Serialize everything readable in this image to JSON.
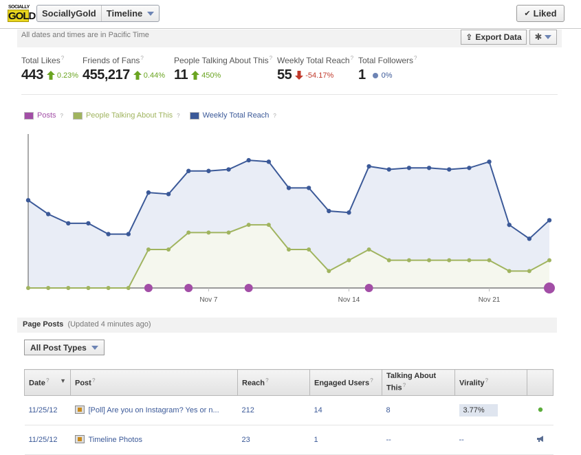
{
  "app": {
    "logo": {
      "line1": "SOCIALLY",
      "line2": "GOLD"
    },
    "page_name": "SociallyGold",
    "view_selector": "Timeline",
    "liked_button": "Liked"
  },
  "toolbar": {
    "timezone_note": "All dates and times are in Pacific Time",
    "export_label": "Export Data",
    "settings_icon": "gear-icon"
  },
  "stats": [
    {
      "label": "Total Likes",
      "value": "443",
      "change": "0.23%",
      "direction": "up"
    },
    {
      "label": "Friends of Fans",
      "value": "455,217",
      "change": "0.44%",
      "direction": "up"
    },
    {
      "label": "People Talking About This",
      "value": "11",
      "change": "450%",
      "direction": "up"
    },
    {
      "label": "Weekly Total Reach",
      "value": "55",
      "change": "-54.17%",
      "direction": "down"
    },
    {
      "label": "Total Followers",
      "value": "1",
      "change": "0%",
      "direction": "neutral"
    }
  ],
  "colors": {
    "posts": "#a24ea6",
    "talking": "#a0b45f",
    "reach": "#3b5998",
    "up": "#6aa421",
    "down": "#c0392b"
  },
  "chart_data": {
    "type": "line",
    "title": "",
    "xlabel": "",
    "ylabel": "",
    "legend": [
      "Posts",
      "People Talking About This",
      "Weekly Total Reach"
    ],
    "legend_position": "top-left",
    "x": [
      "Oct 29",
      "Oct 30",
      "Oct 31",
      "Nov 1",
      "Nov 2",
      "Nov 3",
      "Nov 4",
      "Nov 5",
      "Nov 6",
      "Nov 7",
      "Nov 8",
      "Nov 9",
      "Nov 10",
      "Nov 11",
      "Nov 12",
      "Nov 13",
      "Nov 14",
      "Nov 15",
      "Nov 16",
      "Nov 17",
      "Nov 18",
      "Nov 19",
      "Nov 20",
      "Nov 21",
      "Nov 22",
      "Nov 23",
      "Nov 24"
    ],
    "x_ticks": [
      "Nov 7",
      "Nov 14",
      "Nov 21"
    ],
    "ylim": [
      0,
      100
    ],
    "y_axis_labels_shown": false,
    "series": [
      {
        "name": "Weekly Total Reach",
        "values": [
          57,
          48,
          42,
          42,
          35,
          35,
          62,
          61,
          76,
          76,
          77,
          83,
          82,
          65,
          65,
          50,
          49,
          79,
          77,
          78,
          78,
          77,
          78,
          82,
          41,
          32,
          44
        ]
      },
      {
        "name": "People Talking About This",
        "values": [
          0,
          0,
          0,
          0,
          0,
          0,
          25,
          25,
          36,
          36,
          36,
          41,
          41,
          25,
          25,
          11,
          18,
          25,
          18,
          18,
          18,
          18,
          18,
          18,
          11,
          11,
          18
        ]
      }
    ],
    "posts_markers": [
      {
        "x": "Nov 4",
        "size": "normal"
      },
      {
        "x": "Nov 6",
        "size": "normal"
      },
      {
        "x": "Nov 9",
        "size": "normal"
      },
      {
        "x": "Nov 15",
        "size": "normal"
      },
      {
        "x": "Nov 24",
        "size": "large"
      }
    ]
  },
  "page_posts": {
    "title": "Page Posts",
    "updated": "(Updated 4 minutes ago)",
    "filter": "All Post Types",
    "columns": [
      "Date",
      "Post",
      "Reach",
      "Engaged Users",
      "Talking About This",
      "Virality",
      ""
    ],
    "rows": [
      {
        "date": "11/25/12",
        "post": "[Poll] Are you on Instagram? Yes or n...",
        "reach": "212",
        "engaged": "14",
        "talking": "8",
        "virality": "3.77%",
        "status_icon": "green-dot-icon"
      },
      {
        "date": "11/25/12",
        "post": "Timeline Photos",
        "reach": "23",
        "engaged": "1",
        "talking": "--",
        "virality": "--",
        "status_icon": "megaphone-icon"
      }
    ]
  }
}
